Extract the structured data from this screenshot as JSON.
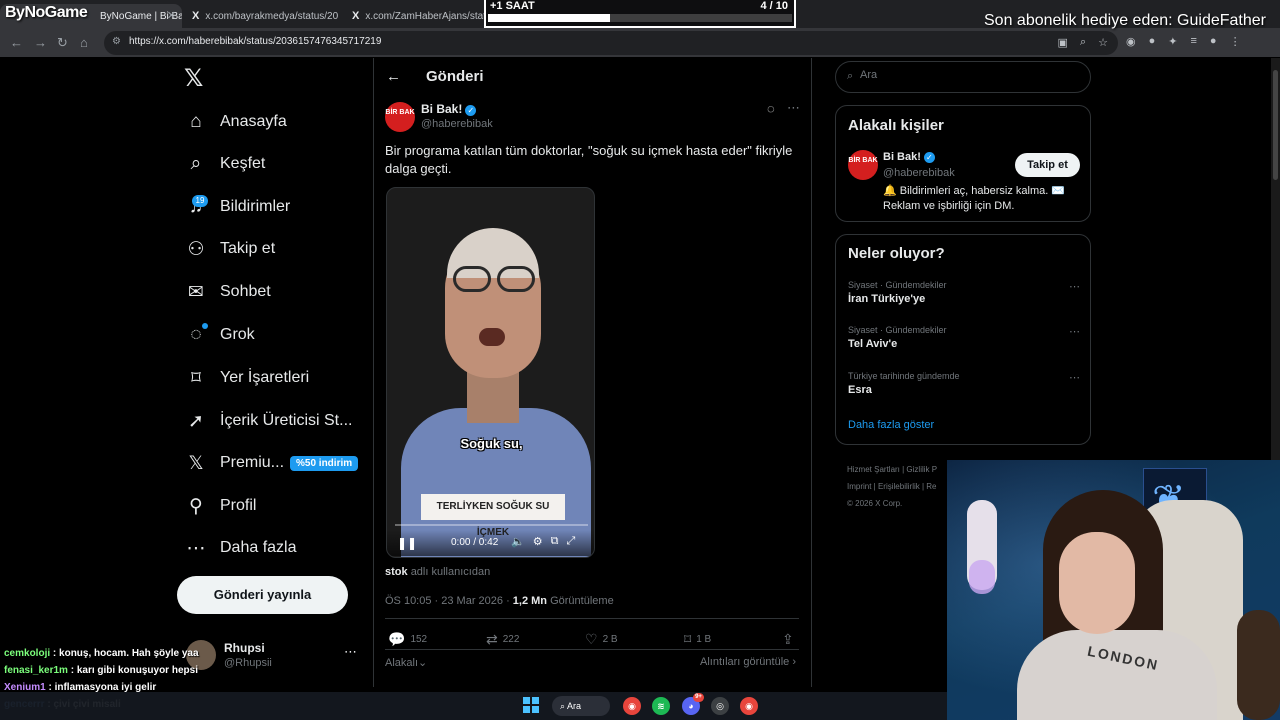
{
  "browser": {
    "tabs": [
      {
        "label": "ByNoGame | Bi Bak! \"Bir programa"
      },
      {
        "label": "x.com/bayrakmedya/status/20"
      },
      {
        "label": "x.com/ZamHaberAjans/status/2"
      }
    ],
    "url": "https://x.com/haberebibak/status/2036157476345717219"
  },
  "overlay": {
    "brand": "ByNoGame",
    "timer_label": "+1 SAAT",
    "timer_count": "4  / 10",
    "timer_progress": 0.4,
    "sub_gift": "Son abonelik hediye eden: GuideFather"
  },
  "nav": {
    "items": [
      {
        "label": "Anasayfa",
        "icon": "home-icon",
        "glyph": "⌂"
      },
      {
        "label": "Keşfet",
        "icon": "search-icon",
        "glyph": "⌕"
      },
      {
        "label": "Bildirimler",
        "icon": "bell-icon",
        "glyph": "♫"
      },
      {
        "label": "Takip et",
        "icon": "follow-icon",
        "glyph": "⚇"
      },
      {
        "label": "Sohbet",
        "icon": "mail-icon",
        "glyph": "✉"
      },
      {
        "label": "Grok",
        "icon": "grok-icon",
        "glyph": "◌"
      },
      {
        "label": "Yer İşaretleri",
        "icon": "bookmark-icon",
        "glyph": "⌑"
      },
      {
        "label": "İçerik Üreticisi St...",
        "icon": "rocket-icon",
        "glyph": "➚"
      },
      {
        "label": "Premiu...",
        "icon": "x-logo-icon",
        "glyph": "𝕏"
      },
      {
        "label": "Profil",
        "icon": "profile-icon",
        "glyph": "⚲"
      },
      {
        "label": "Daha fazla",
        "icon": "more-circle-icon",
        "glyph": "⋯"
      }
    ],
    "notif_count": "19",
    "premium_badge": "%50 indirim",
    "post_button": "Gönderi yayınla",
    "account_name": "Rhupsi",
    "account_handle": "@Rhupsii"
  },
  "post": {
    "header": "Gönderi",
    "author_name": "Bi Bak!",
    "author_handle": "@haberebibak",
    "avatar_text": "BİR BAK",
    "text": "Bir programa katılan tüm doktorlar, \"soğuk su içmek hasta eder\" fikriyle dalga geçti.",
    "video": {
      "subtitle_1": "Soğuk su,",
      "subtitle_2": "TERLİYKEN SOĞUK SU İÇMEK",
      "time": "0:00 / 0:42"
    },
    "from_user": "stok",
    "from_user_suffix": "adlı kullanıcıdan",
    "timestamp": "ÖS 10:05 · 23 Mar 2026 · ",
    "views": "1,2 Mn",
    "views_label": "Görüntüleme",
    "stats": {
      "replies": "152",
      "reposts": "222",
      "likes": "2 B",
      "bookmarks": "1 B"
    },
    "related_sort": "Alakalı",
    "quotes_link": "Alıntıları görüntüle ›"
  },
  "sidebar": {
    "search_placeholder": "Ara",
    "related_title": "Alakalı kişiler",
    "related": {
      "name": "Bi Bak!",
      "handle": "@haberebibak",
      "follow": "Takip et",
      "bio": "🔔 Bildirimleri aç, habersiz kalma. ✉️ Reklam ve işbirliği için DM."
    },
    "trends_title": "Neler oluyor?",
    "trends": [
      {
        "category": "Siyaset · Gündemdekiler",
        "name": "İran Türkiye'ye"
      },
      {
        "category": "Siyaset · Gündemdekiler",
        "name": "Tel Aviv'e"
      },
      {
        "category": "Türkiye tarihinde gündemde",
        "name": "Esra"
      }
    ],
    "show_more": "Daha fazla göster",
    "footer": [
      "Hizmet Şartları | Gizlilik P",
      "Imprint | Erişilebilirlik | Re",
      "© 2026 X Corp."
    ]
  },
  "chat": [
    {
      "user": "cemkoloji",
      "color": "#7cff7c",
      "msg": "konuş, hocam. Hah şöyle yaa"
    },
    {
      "user": "fenasi_ker1m",
      "color": "#7cff7c",
      "msg": "karı gibi konuşuyor hepsi"
    },
    {
      "user": "Xenium1",
      "color": "#c58cff",
      "msg": "inflamasyona iyi gelir"
    },
    {
      "user": "gencerrr",
      "color": "#6fb4ff",
      "msg": "çivi çivi misali"
    }
  ],
  "webcam": {
    "shirt_text": "LONDON"
  },
  "taskbar": {
    "search_label": "Ara",
    "discord_badge": "9+"
  }
}
